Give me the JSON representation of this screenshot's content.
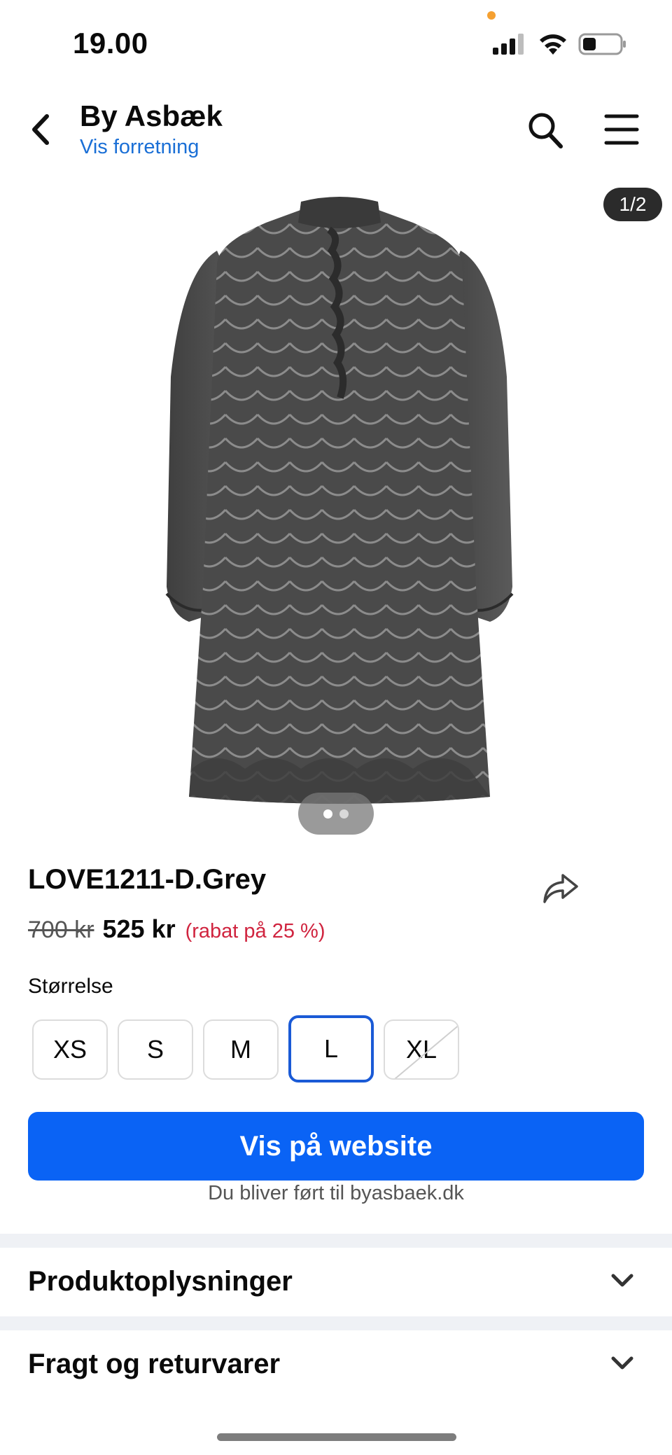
{
  "status_bar": {
    "time": "19.00"
  },
  "header": {
    "shop_name": "By Asbæk",
    "shop_link": "Vis forretning"
  },
  "gallery": {
    "counter": "1/2",
    "total_images": 2,
    "current_index": 1
  },
  "product": {
    "title": "LOVE1211-D.Grey",
    "old_price": "700 kr",
    "price": "525 kr",
    "discount": "(rabat på 25 %)",
    "size_label": "Størrelse",
    "sizes": [
      {
        "label": "XS",
        "selected": false,
        "available": true
      },
      {
        "label": "S",
        "selected": false,
        "available": true
      },
      {
        "label": "M",
        "selected": false,
        "available": true
      },
      {
        "label": "L",
        "selected": true,
        "available": true
      },
      {
        "label": "XL",
        "selected": false,
        "available": false
      }
    ]
  },
  "cta": {
    "label": "Vis på website",
    "note": "Du bliver ført til byasbaek.dk"
  },
  "accordion": [
    {
      "title": "Produktoplysninger"
    },
    {
      "title": "Fragt og returvarer"
    }
  ],
  "colors": {
    "accent": "#0a63f5",
    "link": "#1a6fd6",
    "discount": "#d0243f",
    "selected_border": "#1a5ad6"
  }
}
